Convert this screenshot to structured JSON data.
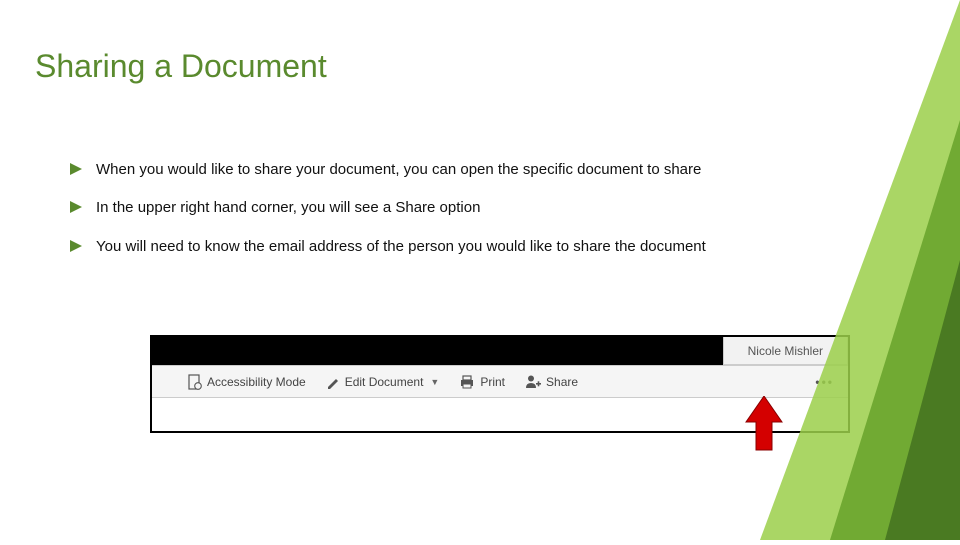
{
  "title": "Sharing a Document",
  "bullets": [
    "When you would like to share your document, you can open the specific document to share",
    "In the upper right hand corner, you will see a Share option",
    "You will need to know the email address of the person you would like to share the document"
  ],
  "screenshot": {
    "username": "Nicole Mishler",
    "toolbar": {
      "accessibility": "Accessibility Mode",
      "edit": "Edit Document",
      "print": "Print",
      "share": "Share"
    }
  },
  "colors": {
    "title": "#5a8a2e",
    "accent_dark": "#4a7a22",
    "accent_light": "#9bcf4a",
    "arrow_red": "#d40000"
  }
}
